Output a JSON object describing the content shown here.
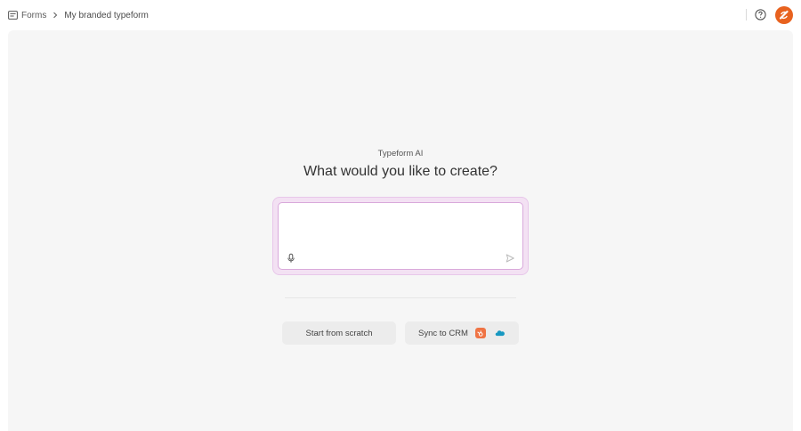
{
  "header": {
    "breadcrumb_root": "Forms",
    "breadcrumb_current": "My branded typeform"
  },
  "main": {
    "kicker": "Typeform AI",
    "headline": "What would you like to create?",
    "prompt_value": "",
    "start_button": "Start from scratch",
    "sync_button": "Sync to CRM"
  },
  "icons": {
    "forms": "forms-icon",
    "breadcrumb_sep": "chevron-right-icon",
    "help": "help-circle-icon",
    "mic": "microphone-icon",
    "send": "send-icon",
    "hubspot": "hubspot-icon",
    "salesforce": "salesforce-icon"
  },
  "colors": {
    "accent_border": "#d9a9db",
    "glow": "#f3e1f3",
    "avatar": "#e8621f",
    "hubspot": "#ef7445",
    "salesforce": "#1798c1"
  }
}
